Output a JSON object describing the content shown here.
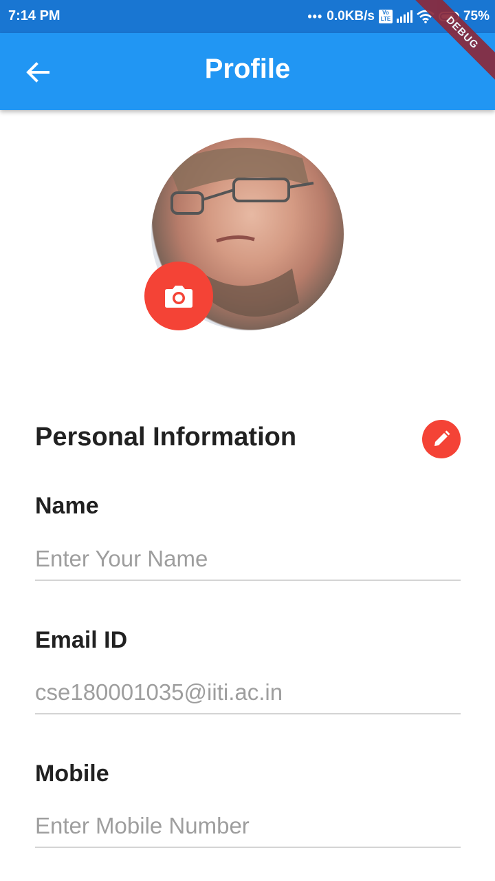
{
  "status_bar": {
    "time": "7:14 PM",
    "network_speed": "0.0KB/s",
    "volte_label": "Vo LTE",
    "battery": "75%",
    "icons": [
      "signal-icon",
      "wifi-icon",
      "battery-icon"
    ]
  },
  "app_bar": {
    "title": "Profile",
    "back_icon": "arrow-back-icon"
  },
  "debug_banner": "DEBUG",
  "profile": {
    "camera_icon": "camera-icon"
  },
  "personal_info": {
    "title": "Personal Information",
    "edit_icon": "pencil-icon",
    "fields": [
      {
        "label": "Name",
        "value": "",
        "placeholder": "Enter Your Name"
      },
      {
        "label": "Email ID",
        "value": "",
        "placeholder": "cse180001035@iiti.ac.in"
      },
      {
        "label": "Mobile",
        "value": "",
        "placeholder": "Enter Mobile Number"
      }
    ]
  },
  "colors": {
    "status_bar": "#1976d2",
    "app_bar": "#2196f3",
    "accent": "#f44336",
    "text": "#212121",
    "hint": "#9e9e9e"
  }
}
